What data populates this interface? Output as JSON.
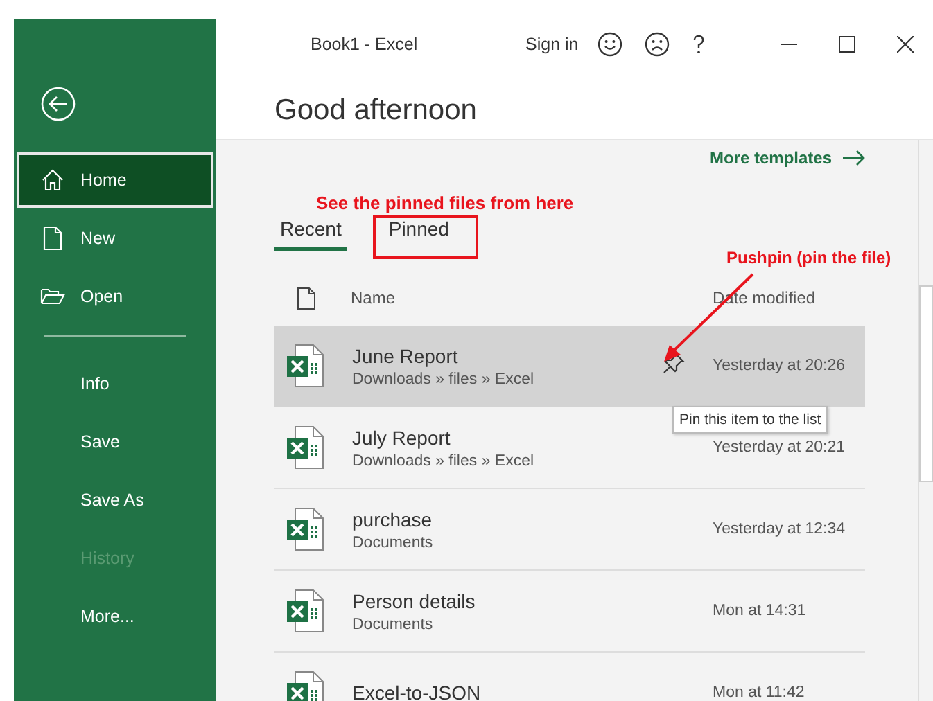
{
  "window": {
    "title": "Book1  -  Excel",
    "sign_in": "Sign in"
  },
  "sidebar": {
    "groups": [
      [
        {
          "label": "Home",
          "selected": true,
          "disabled": false
        },
        {
          "label": "New",
          "selected": false,
          "disabled": false
        },
        {
          "label": "Open",
          "selected": false,
          "disabled": false
        }
      ],
      [
        {
          "label": "Info",
          "selected": false,
          "disabled": false
        },
        {
          "label": "Save",
          "selected": false,
          "disabled": false
        },
        {
          "label": "Save As",
          "selected": false,
          "disabled": false
        },
        {
          "label": "History",
          "selected": false,
          "disabled": true
        },
        {
          "label": "More...",
          "selected": false,
          "disabled": false
        }
      ]
    ]
  },
  "greeting": "Good afternoon",
  "more_templates": "More templates",
  "tabs": [
    {
      "label": "Recent",
      "selected": true
    },
    {
      "label": "Pinned",
      "selected": false
    }
  ],
  "columns": [
    "Name",
    "Date modified"
  ],
  "files": [
    {
      "name": "June Report",
      "path": "Downloads » files » Excel",
      "date": "Yesterday at 20:26",
      "hovered": true
    },
    {
      "name": "July Report",
      "path": "Downloads » files » Excel",
      "date": "Yesterday at 20:21",
      "hovered": false
    },
    {
      "name": "purchase",
      "path": "Documents",
      "date": "Yesterday at 12:34",
      "hovered": false
    },
    {
      "name": "Person details",
      "path": "Documents",
      "date": "Mon at 14:31",
      "hovered": false
    },
    {
      "name": "Excel-to-JSON",
      "date": "Mon at 11:42",
      "hovered": false
    }
  ],
  "tooltip": "Pin this item to the list",
  "annotations": [
    "See the pinned files from here",
    "Pushpin (pin the file)"
  ]
}
